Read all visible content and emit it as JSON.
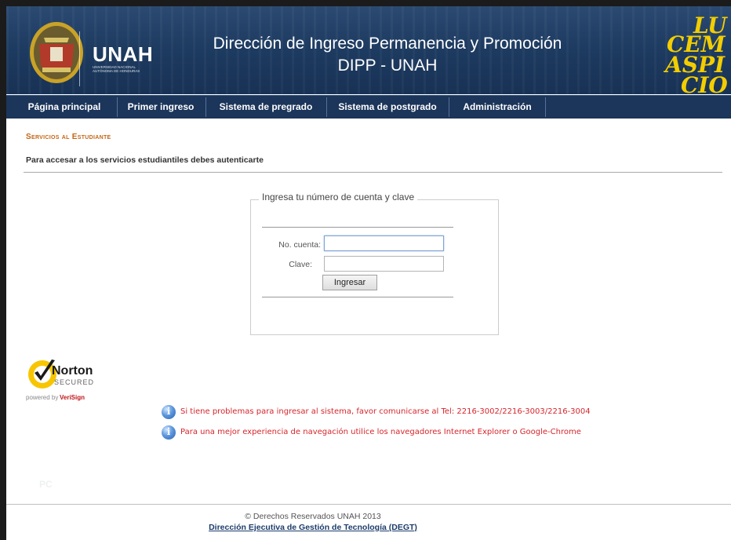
{
  "header": {
    "logo_text": "UNAH",
    "logo_subtitle": "UNIVERSIDAD NACIONAL AUTÓNOMA DE HONDURAS",
    "title_line1": "Dirección de Ingreso Permanencia y Promoción",
    "title_line2": "DIPP - UNAH",
    "corner_text": [
      "LU",
      "CEM",
      "ASPI",
      "CIO"
    ]
  },
  "nav": {
    "items": [
      "Página principal",
      "Primer ingreso",
      "Sistema de pregrado",
      "Sistema de postgrado",
      "Administración"
    ]
  },
  "main": {
    "section_title": "Servicios al Estudiante",
    "auth_instruction": "Para accesar a los servicios estudiantiles debes autenticarte",
    "login": {
      "legend": "Ingresa tu número de cuenta y clave",
      "account_label": "No. cuenta:",
      "account_value": "",
      "password_label": "Clave:",
      "password_value": "",
      "submit_label": "Ingresar"
    },
    "badge": {
      "name": "Norton",
      "secured": "SECURED",
      "powered_by": "powered by",
      "provider": "VeriSign"
    },
    "notices": [
      "Si tiene problemas para ingresar al sistema, favor comunicarse al Tel: 2216-3002/2216-3003/2216-3004",
      "Para una mejor experiencia de navegación utilice los navegadores Internet Explorer o Google-Chrome"
    ],
    "watermark": "PC"
  },
  "footer": {
    "copyright": "© Derechos Reservados UNAH 2013",
    "link_text": "Dirección Ejecutiva de Gestión de Tecnología (DEGT)"
  },
  "colors": {
    "header_bg": "#1d3a60",
    "nav_bg": "#1c355a",
    "section_title": "#c46515",
    "notice_text": "#d6262c",
    "corner_yellow": "#f2cd00"
  }
}
